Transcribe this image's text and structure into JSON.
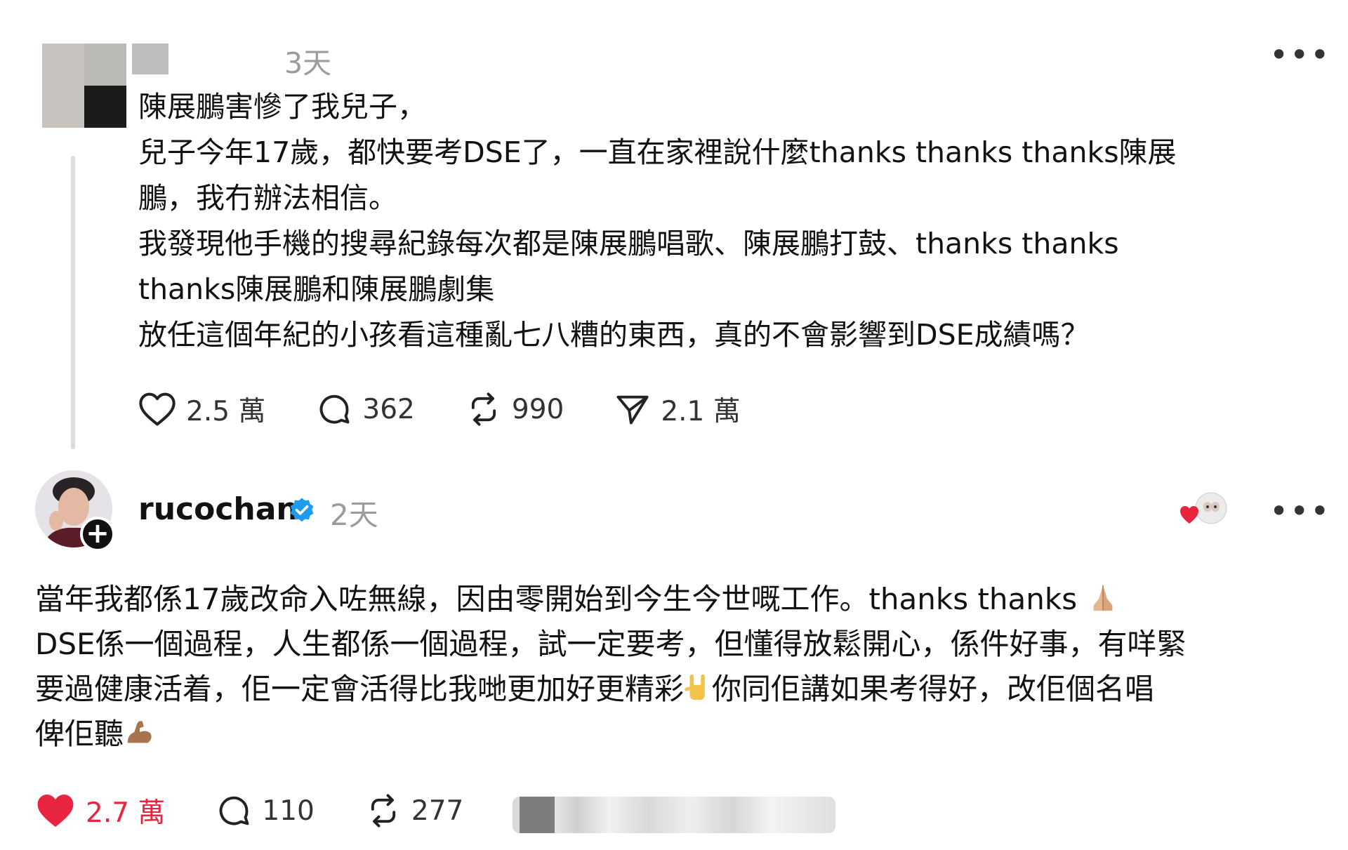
{
  "post": {
    "time": "3天",
    "lines": [
      "陳展鵬害慘了我兒子，",
      "兒子今年17歲，都快要考DSE了，一直在家裡說什麼thanks thanks thanks陳展",
      "鵬，我冇辦法相信。",
      "我發現他手機的搜尋紀錄每次都是陳展鵬唱歌、陳展鵬打鼓、thanks thanks",
      "thanks陳展鵬和陳展鵬劇集",
      "放任這個年紀的小孩看這種亂七八糟的東西，真的不會影響到DSE成績嗎？"
    ],
    "actions": {
      "like_count": "2.5 萬",
      "comment_count": "362",
      "repost_count": "990",
      "share_count": "2.1 萬"
    }
  },
  "reply": {
    "username": "rucochan",
    "time": "2天",
    "lines": [
      {
        "text": "當年我都係17歲改命入咗無線￼，因由零開始到今生今世嘅工作￼￼。thanks thanks ",
        "emoji": "praying-hands"
      },
      {
        "text": "DSE係一個過程，人生都係一個過程，試一定要考，但懂得放鬆開心，係件好事，有咩緊",
        "emoji": null
      },
      {
        "text": "要過健康活着，佢一定會活得比我哋更加好更精彩￼",
        "emoji": "rock-hand",
        "after": "你同佢講如果考得好，改佢個名唱"
      },
      {
        "text": "俾佢聽",
        "emoji": "flexed-biceps"
      }
    ],
    "actions": {
      "like_count": "2.7 萬",
      "comment_count": "110",
      "repost_count": "277"
    }
  },
  "colors": {
    "like_active": "#e8243e",
    "verified_blue": "#1d9bf0",
    "muted_text": "#9c9c9c"
  }
}
